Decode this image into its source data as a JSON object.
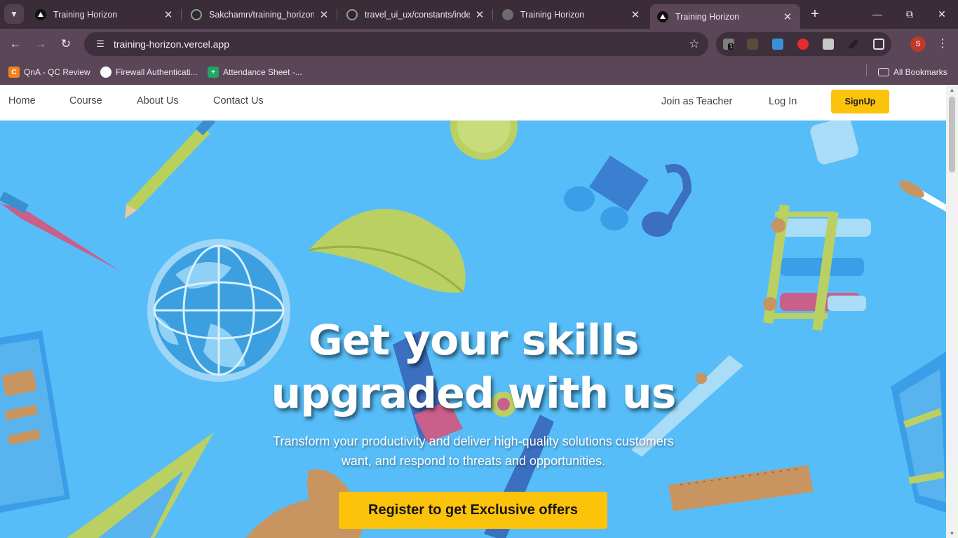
{
  "browser": {
    "tabs": [
      {
        "title": "Training Horizon",
        "icon": "vercel-triangle-icon"
      },
      {
        "title": "Sakchamn/training_horizon",
        "icon": "github-icon"
      },
      {
        "title": "travel_ui_ux/constants/index",
        "icon": "github-icon"
      },
      {
        "title": "Training Horizon",
        "icon": "globe-icon"
      },
      {
        "title": "Training Horizon",
        "icon": "vercel-triangle-icon",
        "active": true
      }
    ],
    "url": "training-horizon.vercel.app",
    "extension_badge": "1",
    "profile_initial": "S",
    "bookmarks": [
      {
        "label": "QnA - QC Review",
        "icon": "c-icon",
        "color": "#f5821f"
      },
      {
        "label": "Firewall Authenticati...",
        "icon": "globe-icon",
        "color": "#ffffff"
      },
      {
        "label": "Attendance Sheet -...",
        "icon": "sheets-icon",
        "color": "#21a464"
      }
    ],
    "all_bookmarks": "All Bookmarks"
  },
  "site": {
    "nav": {
      "home": "Home",
      "course": "Course",
      "about": "About Us",
      "contact": "Contact Us",
      "join_teacher": "Join as Teacher",
      "login": "Log In",
      "signup": "SignUp"
    },
    "hero": {
      "headline_line1": "Get your skills",
      "headline_line2": "upgraded with us",
      "subtext_line1": "Transform your productivity and deliver high-quality solutions customers",
      "subtext_line2": "want, and respond to threats and opportunities.",
      "cta": "Register to get Exclusive offers"
    },
    "colors": {
      "hero_bg": "#57bdf8",
      "accent": "#fcc30b",
      "nav_bg": "#ffffff"
    }
  }
}
